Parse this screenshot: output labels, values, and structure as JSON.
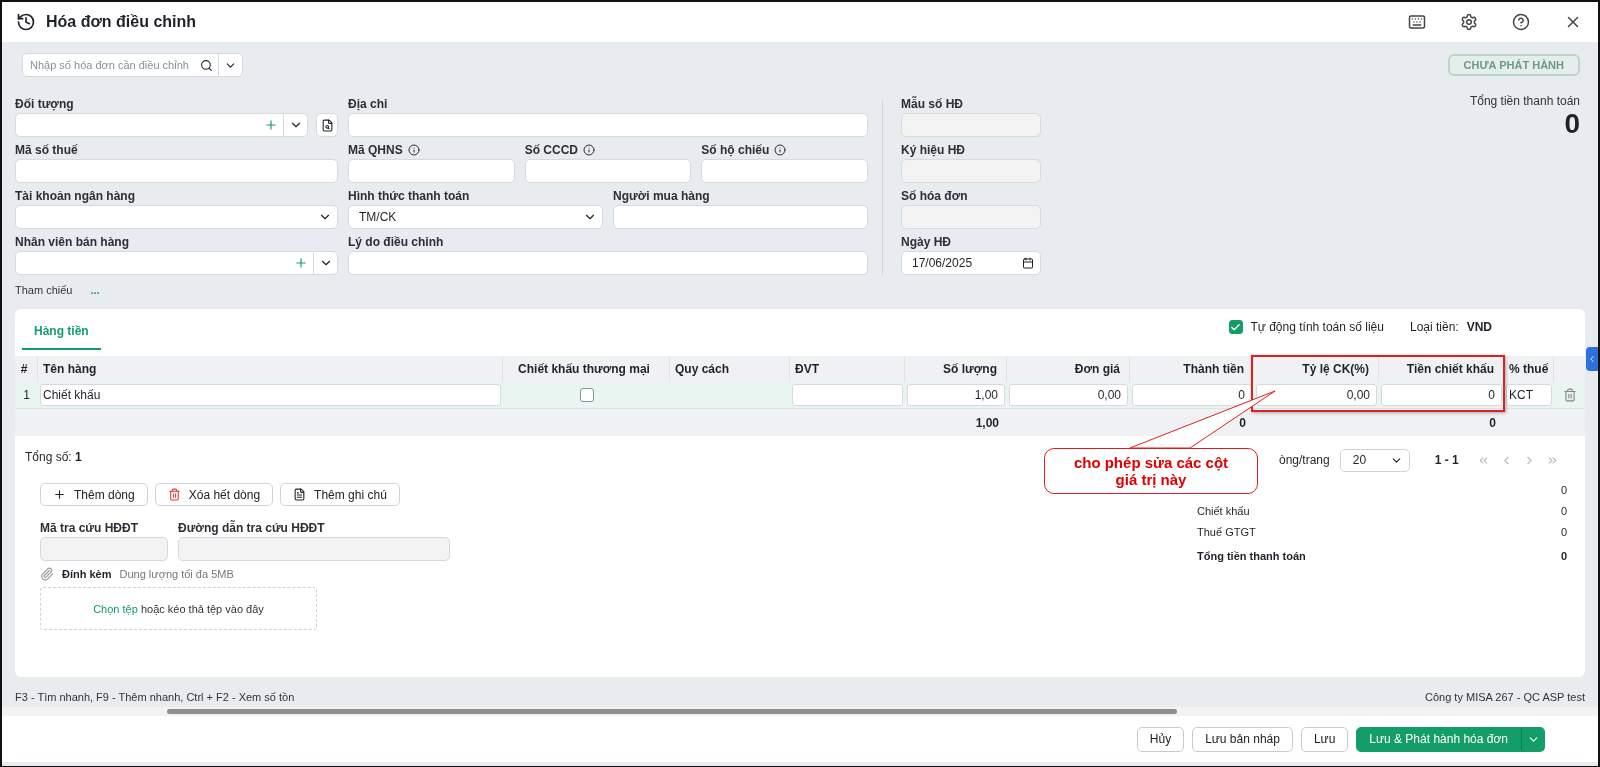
{
  "window": {
    "title": "Hóa đơn điều chỉnh"
  },
  "search": {
    "placeholder": "Nhập số hóa đơn cần điều chỉnh"
  },
  "status_badge": "CHƯA PHÁT HÀNH",
  "form": {
    "rows": [
      [
        {
          "label": "Đối tượng",
          "kind": "combo_add"
        },
        {
          "label": "Địa chỉ",
          "kind": "text"
        }
      ],
      [
        {
          "label": "Mã số thuế",
          "kind": "text"
        },
        {
          "label": "Mã QHNS",
          "kind": "text",
          "info": true
        },
        {
          "label": "Số CCCD",
          "kind": "text",
          "info": true
        },
        {
          "label": "Số hộ chiếu",
          "kind": "text",
          "info": true
        }
      ],
      [
        {
          "label": "Tài khoản ngân hàng",
          "kind": "select"
        },
        {
          "label": "Hình thức thanh toán",
          "kind": "select",
          "value": "TM/CK"
        },
        {
          "label": "Người mua hàng",
          "kind": "text"
        }
      ],
      [
        {
          "label": "Nhân viên bán hàng",
          "kind": "combo_add_plain"
        },
        {
          "label": "Lý do điều chỉnh",
          "kind": "text"
        }
      ]
    ],
    "invoice_fields": [
      {
        "label": "Mẫu số HĐ",
        "kind": "readonly"
      },
      {
        "label": "Ký hiệu HĐ",
        "kind": "readonly"
      },
      {
        "label": "Số hóa đơn",
        "kind": "readonly"
      },
      {
        "label": "Ngày HĐ",
        "kind": "date",
        "value": "17/06/2025"
      }
    ]
  },
  "total": {
    "label": "Tổng tiền thanh toán",
    "value": "0"
  },
  "reference": {
    "label": "Tham chiếu",
    "value": "..."
  },
  "tabs": [
    {
      "label": "Hàng tiền",
      "selected": true
    }
  ],
  "auto_calc": {
    "label": "Tự động tính toán số liệu",
    "checked": true
  },
  "currency": {
    "label": "Loại tiền:",
    "value": "VND"
  },
  "table": {
    "columns": [
      "#",
      "Tên hàng",
      "Chiết khấu thương mại",
      "Quy cách",
      "ĐVT",
      "Số lượng",
      "Đơn giá",
      "Thành tiền",
      "Tỷ lệ CK(%)",
      "Tiền chiết khấu",
      "% thuế"
    ],
    "rows": [
      {
        "index": "1",
        "name": "Chiết khấu",
        "trade_discount": false,
        "quantity": "1,00",
        "unit_price": "0,00",
        "amount": "0",
        "discount_rate": "0,00",
        "discount_amount": "0",
        "vat": "KCT"
      }
    ],
    "totals": {
      "quantity": "1,00",
      "amount": "0",
      "discount_amount": "0"
    }
  },
  "total_count": {
    "label": "Tổng số:",
    "value": "1"
  },
  "pagination": {
    "per_page_label": "òng/trang",
    "per_page": "20",
    "range": "1 - 1"
  },
  "actions": [
    {
      "label": "Thêm dòng",
      "kind": "add"
    },
    {
      "label": "Xóa hết dòng",
      "kind": "delete"
    },
    {
      "label": "Thêm ghi chú",
      "kind": "note"
    }
  ],
  "lookup": [
    {
      "label": "Mã tra cứu HĐĐT"
    },
    {
      "label": "Đường dẫn tra cứu HĐĐT"
    }
  ],
  "attachment": {
    "label": "Đính kèm",
    "hint": "Dung lượng tối đa 5MB",
    "link": "Chọn tệp",
    "drop_text": "hoặc kéo thả tệp vào đây"
  },
  "summary": [
    {
      "value": "0",
      "kind": "normal"
    },
    {
      "label": "Chiết khấu",
      "value": "0",
      "kind": "normal"
    },
    {
      "label": "Thuế GTGT",
      "value": "0",
      "kind": "normal"
    },
    {
      "label": "Tổng tiền thanh toán",
      "value": "0",
      "kind": "total"
    }
  ],
  "annotation": {
    "text": "cho phép sửa các cột giá trị này"
  },
  "status_bar": {
    "shortcuts": "F3 - Tìm nhanh, F9 - Thêm nhanh, Ctrl + F2 - Xem số tồn",
    "company": "Công ty MISA 267 - QC ASP test"
  },
  "footer_buttons": [
    {
      "label": "Hủy",
      "kind": "default"
    },
    {
      "label": "Lưu bản nháp",
      "kind": "default"
    },
    {
      "label": "Lưu",
      "kind": "default"
    },
    {
      "label": "Lưu & Phát hành hóa đơn",
      "kind": "primary"
    }
  ]
}
